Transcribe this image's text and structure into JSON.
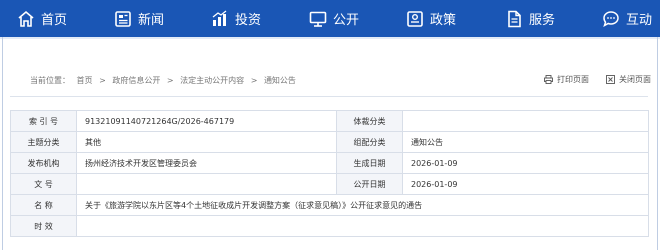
{
  "nav": {
    "items": [
      {
        "label": "首页",
        "icon": "home-icon"
      },
      {
        "label": "新闻",
        "icon": "newspaper-icon"
      },
      {
        "label": "投资",
        "icon": "chart-icon"
      },
      {
        "label": "公开",
        "icon": "monitor-icon"
      },
      {
        "label": "政策",
        "icon": "policy-icon"
      },
      {
        "label": "服务",
        "icon": "document-icon"
      },
      {
        "label": "互动",
        "icon": "chat-icon"
      }
    ]
  },
  "breadcrumb": {
    "prefix": "当前位置：",
    "items": [
      "首页",
      "政府信息公开",
      "法定主动公开内容",
      "通知公告"
    ],
    "separator": ">"
  },
  "actions": {
    "print_label": "打印页面",
    "close_label": "关闭页面"
  },
  "info_table": {
    "rows": [
      {
        "k1": "索 引 号",
        "v1": "91321091140721264G/2026-467179",
        "k2": "体裁分类",
        "v2": ""
      },
      {
        "k1": "主题分类",
        "v1": "其他",
        "k2": "组配分类",
        "v2": "通知公告"
      },
      {
        "k1": "发布机构",
        "v1": "扬州经济技术开发区管理委员会",
        "k2": "生成日期",
        "v2": "2026-01-09"
      },
      {
        "k1": "文 号",
        "v1": "",
        "k2": "公开日期",
        "v2": "2026-01-09"
      }
    ],
    "name_label": "名 称",
    "name_value": "关于《旅游学院以东片区等4个土地征收成片开发调整方案（征求意见稿）》公开征求意见的通告",
    "validity_label": "时 效",
    "validity_value": ""
  },
  "colors": {
    "nav_bg": "#1a56b5",
    "label_bg": "#f3f5f9",
    "border": "#d8dee8"
  }
}
